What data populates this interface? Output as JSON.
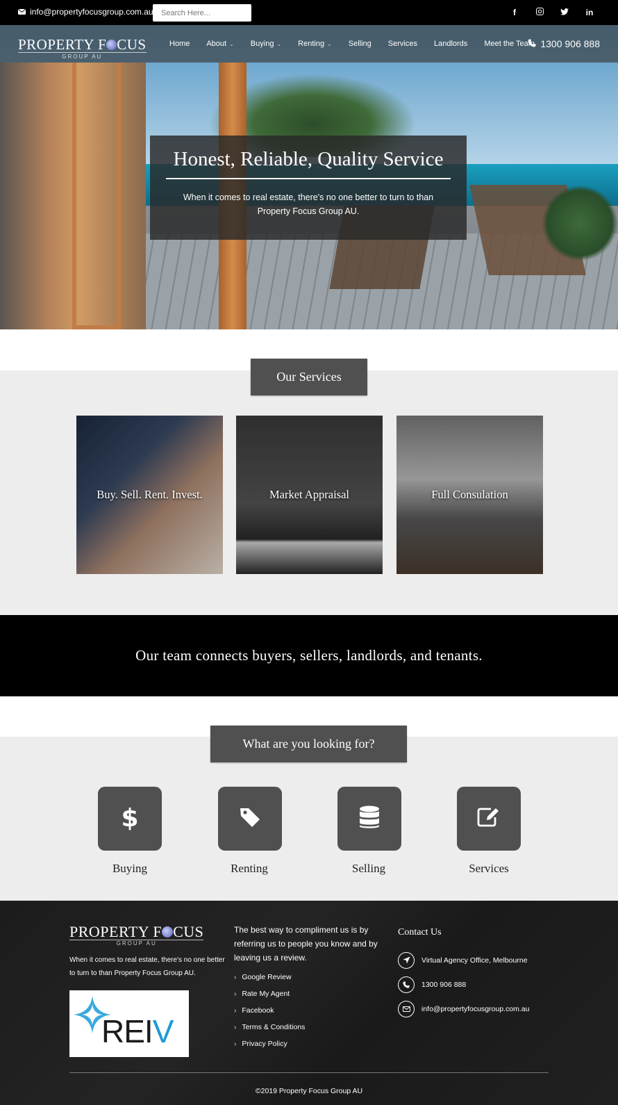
{
  "topbar": {
    "email": "info@propertyfocusgroup.com.au",
    "search_placeholder": "Search Here...",
    "socials": [
      "f",
      "instagram-icon",
      "twitter-icon",
      "in"
    ]
  },
  "brand": {
    "logo_main_a": "PROPERTY F",
    "logo_main_b": "CUS",
    "logo_sub": "GROUP AU"
  },
  "nav": {
    "items": [
      {
        "label": "Home",
        "dropdown": false
      },
      {
        "label": "About",
        "dropdown": true
      },
      {
        "label": "Buying",
        "dropdown": true
      },
      {
        "label": "Renting",
        "dropdown": true
      },
      {
        "label": "Selling",
        "dropdown": false
      },
      {
        "label": "Services",
        "dropdown": false
      },
      {
        "label": "Landlords",
        "dropdown": false
      },
      {
        "label": "Meet the Team",
        "dropdown": false
      }
    ],
    "phone": "1300 906 888"
  },
  "hero": {
    "title": "Honest, Reliable, Quality Service",
    "subtitle": "When it comes to real estate, there's no one better to turn to than Property Focus Group AU."
  },
  "services": {
    "title": "Our Services",
    "cards": [
      {
        "label": "Buy. Sell. Rent. Invest."
      },
      {
        "label": "Market Appraisal"
      },
      {
        "label": "Full Consulation"
      }
    ]
  },
  "banner": {
    "text": "Our team connects buyers, sellers, landlords, and tenants."
  },
  "looking": {
    "title": "What are you looking for?",
    "tiles": [
      {
        "label": "Buying",
        "icon": "dollar-icon"
      },
      {
        "label": "Renting",
        "icon": "tag-icon"
      },
      {
        "label": "Selling",
        "icon": "database-icon"
      },
      {
        "label": "Services",
        "icon": "edit-icon"
      }
    ]
  },
  "footer": {
    "description": "When it comes to real estate, there's no one better to turn to than Property Focus Group AU.",
    "reiv_logo": {
      "text_a": "REI",
      "text_b": "V"
    },
    "intro": "The best way to compliment us is by referring us to people you know and by leaving us a review.",
    "links": [
      "Google Review",
      "Rate My Agent",
      "Facebook",
      "Terms & Conditions",
      "Privacy Policy"
    ],
    "contact_title": "Contact Us",
    "contact": [
      {
        "text": "Virtual Agency Office, Melbourne",
        "icon": "location-arrow-icon"
      },
      {
        "text": "1300 906 888",
        "icon": "phone-icon"
      },
      {
        "text": "info@propertyfocusgroup.com.au",
        "icon": "envelope-icon"
      }
    ],
    "copyright": "©2019 Property Focus Group AU"
  },
  "colors": {
    "tile_bg": "#505050",
    "section_bg": "#ededed",
    "banner_bg": "#000000",
    "reiv_blue": "#1b9ad6"
  }
}
